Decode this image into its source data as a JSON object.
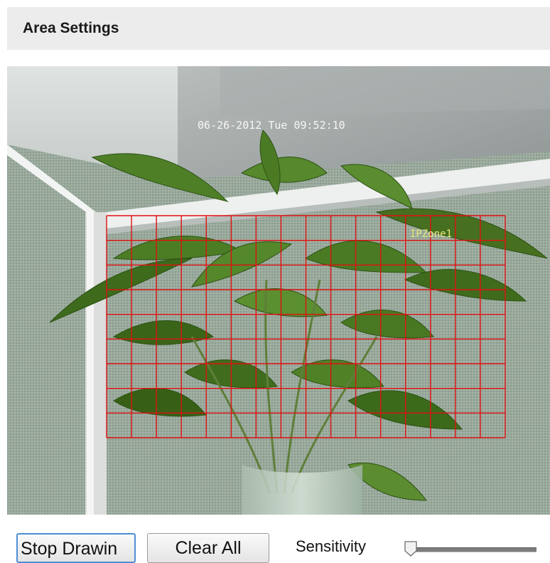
{
  "header": {
    "title": "Area Settings"
  },
  "video": {
    "timestamp": "06-26-2012 Tue 09:52:10",
    "zone_label": "IPZone1",
    "grid_color": "#e01010",
    "grid_rows": 9,
    "grid_cols": 16
  },
  "controls": {
    "stop_drawing_label": "Stop Drawin",
    "clear_all_label": "Clear All",
    "sensitivity_label": "Sensitivity",
    "sensitivity_value": 0
  },
  "colors": {
    "header_bg": "#ececec",
    "focus_border": "#4d8fd4",
    "slider_track": "#7d7d7d"
  }
}
